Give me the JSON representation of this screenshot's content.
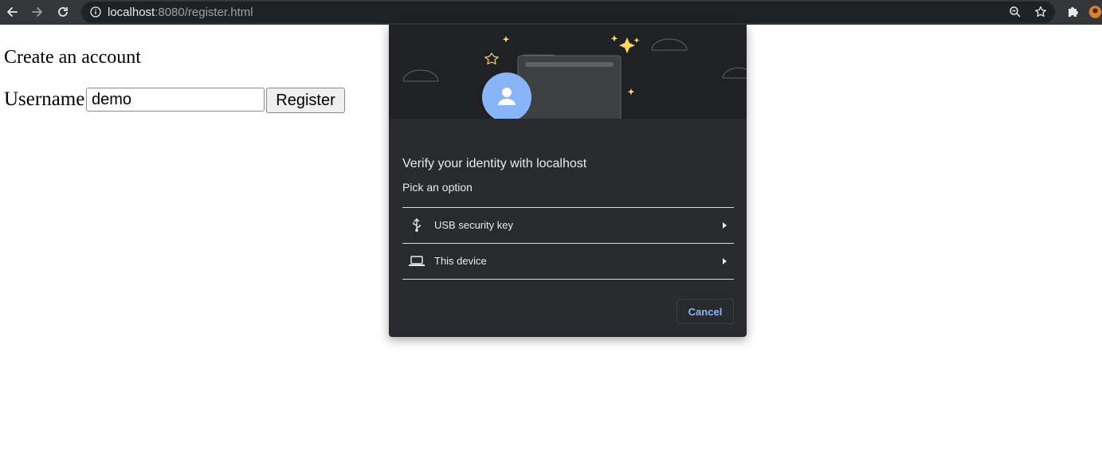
{
  "browser": {
    "url_host": "localhost",
    "url_rest": ":8080/register.html"
  },
  "page": {
    "heading": "Create an account",
    "username_label": "Username",
    "username_value": "demo",
    "register_label": "Register"
  },
  "dialog": {
    "title": "Verify your identity with localhost",
    "subtitle": "Pick an option",
    "options": [
      {
        "label": "USB security key",
        "icon": "usb-icon"
      },
      {
        "label": "This device",
        "icon": "laptop-icon"
      }
    ],
    "cancel_label": "Cancel"
  },
  "colors": {
    "toolbar": "#35363a",
    "omnibox": "#202124",
    "dialog_bg": "#292a2d",
    "accent": "#8ab4f8",
    "avatar": "#8ab4f8",
    "sparkle": "#fdd663"
  }
}
